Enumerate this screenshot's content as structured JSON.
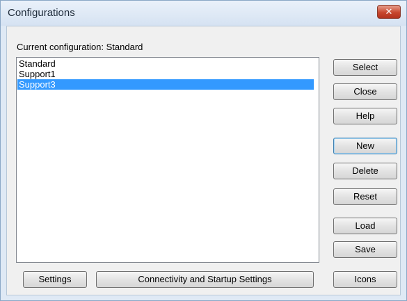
{
  "window": {
    "title": "Configurations",
    "close_label": "✕"
  },
  "current_configuration": {
    "label": "Current configuration:",
    "value": "Standard"
  },
  "configurations": [
    {
      "name": "Standard",
      "selected": false
    },
    {
      "name": "Support1",
      "selected": false
    },
    {
      "name": "Support3",
      "selected": true
    }
  ],
  "buttons": {
    "select": "Select",
    "close": "Close",
    "help": "Help",
    "new": "New",
    "delete": "Delete",
    "reset": "Reset",
    "load": "Load",
    "save": "Save",
    "settings": "Settings",
    "connectivity": "Connectivity and Startup Settings",
    "icons": "Icons"
  },
  "colors": {
    "selection": "#3399ff",
    "close_button": "#c8472e"
  }
}
